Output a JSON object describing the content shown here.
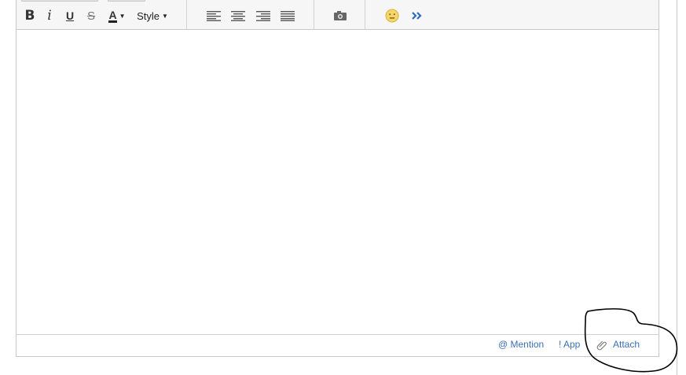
{
  "toolbar": {
    "style_label": "Style",
    "font_color_label": "A"
  },
  "footer": {
    "mention_label": "@ Mention",
    "app_label": "! App",
    "attach_label": "Attach"
  }
}
